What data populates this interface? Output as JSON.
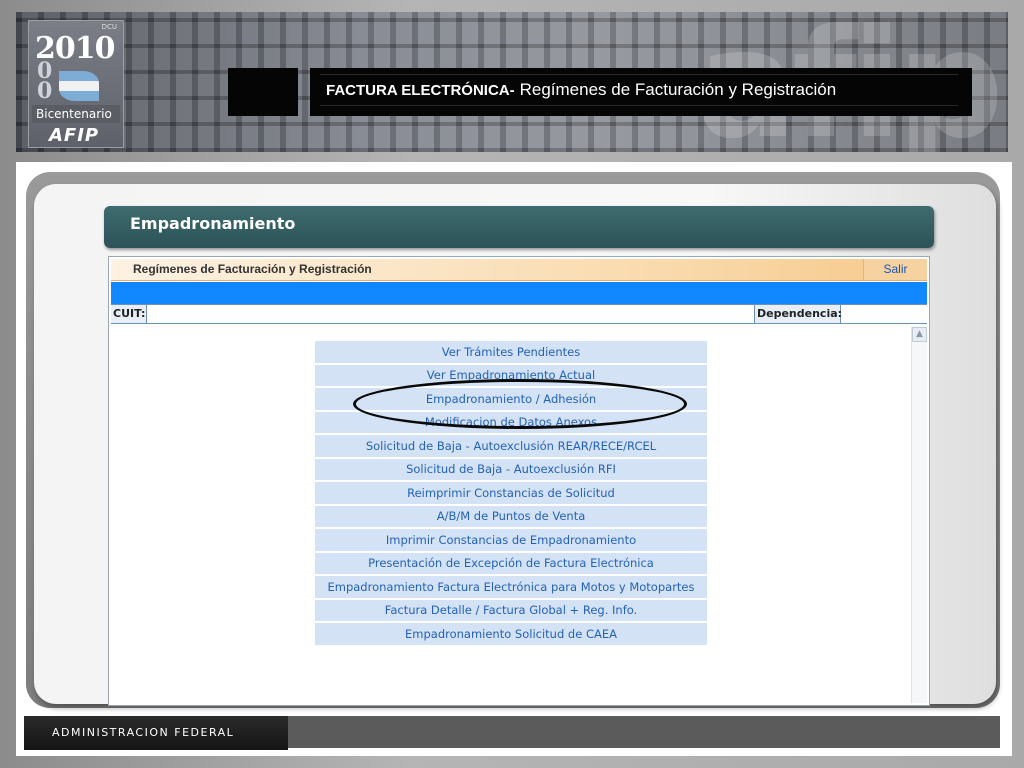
{
  "header": {
    "logo_year": "2010",
    "logo_small_text": "DCU",
    "logo_digits": "0 0",
    "logo_subtitle": "Bicentenario",
    "logo_brand": "AFIP",
    "watermark": "afip",
    "title_strong": "FACTURA ELECTRÓNICA-",
    "title_rest": "Regímenes de Facturación y Registración"
  },
  "section": {
    "title": "Empadronamiento"
  },
  "app": {
    "header_title": "Regímenes de Facturación y Registración",
    "exit_label": "Salir",
    "cuit_label": "CUIT:",
    "cuit_value": "",
    "dependencia_label": "Dependencia:",
    "dependencia_value": "",
    "scroll_up_glyph": "▲",
    "menu_items": [
      "Ver Trámites Pendientes",
      "Ver Empadronamiento Actual",
      "Empadronamiento / Adhesión",
      "Modificacion de Datos Anexos",
      "Solicitud de Baja - Autoexclusión REAR/RECE/RCEL",
      "Solicitud de Baja - Autoexclusión RFI",
      "Reimprimir Constancias de Solicitud",
      "A/B/M de Puntos de Venta",
      "Imprimir Constancias de Empadronamiento",
      "Presentación de Excepción de Factura Electrónica",
      "Empadronamiento Factura Electrónica para Motos y Motopartes",
      "Factura Detalle / Factura Global + Reg. Info.",
      "Empadronamiento Solicitud de CAEA"
    ],
    "highlighted_item_index": 2
  },
  "footer": {
    "label": "ADMINISTRACION FEDERAL"
  },
  "colors": {
    "section_tab": "#2c5357",
    "menu_bg": "#d3e2f4",
    "menu_text": "#2462b8",
    "blue_bar": "#1188ff",
    "header_orange": "#f6c98a"
  }
}
